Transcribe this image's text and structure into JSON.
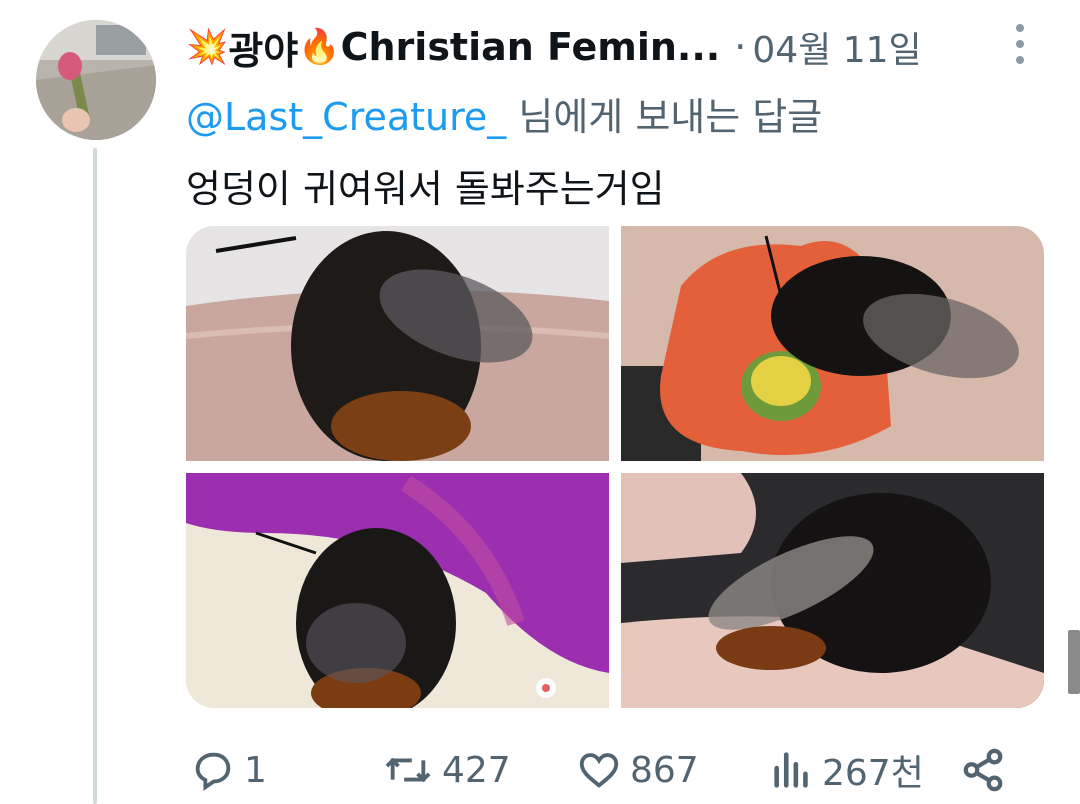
{
  "tweet": {
    "display_name_prefix_emoji": "💥",
    "display_name_part1": "광야",
    "display_name_mid_emoji": "🔥",
    "display_name_part2": "Christian Femin...",
    "separator": "·",
    "date": "04월 11일",
    "reply_handle": "@Last_Creature_",
    "reply_suffix": " 님에게 보내는 답글",
    "text": "엉덩이 귀여워서 돌봐주는거임"
  },
  "media": {
    "count": 4,
    "icons": [
      "bee-on-hand-photo",
      "bee-on-orange-flower-photo",
      "bee-on-purple-flower-photo",
      "bee-held-in-fingers-photo"
    ]
  },
  "actions": {
    "reply_count": "1",
    "retweet_count": "427",
    "like_count": "867",
    "view_count": "267천"
  },
  "colors": {
    "accent": "#1d9bf0",
    "secondary_text": "#536471",
    "thread_line": "#cfd9de"
  }
}
